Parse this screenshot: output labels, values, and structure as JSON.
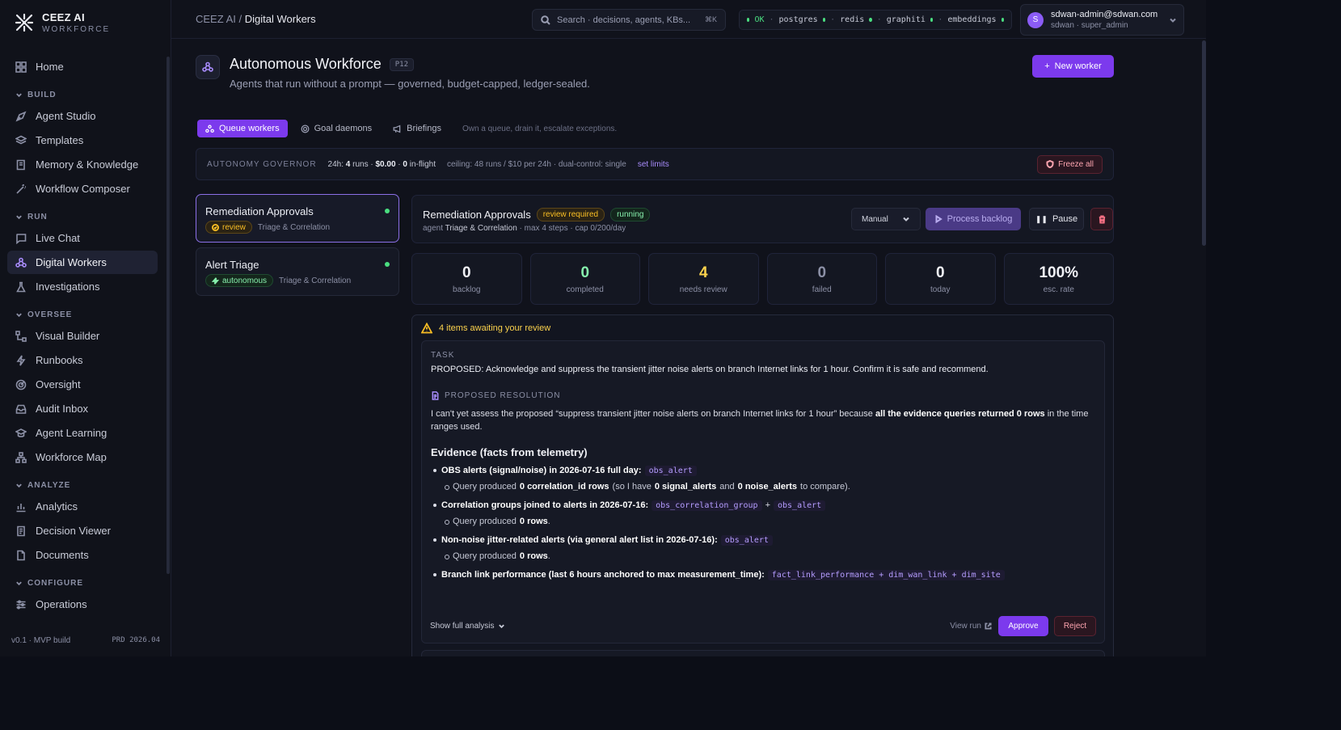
{
  "brand": {
    "name": "CEEZ AI",
    "sub": "WORKFORCE"
  },
  "sidebar": {
    "home": "Home",
    "build": {
      "title": "BUILD",
      "items": [
        "Agent Studio",
        "Templates",
        "Memory & Knowledge",
        "Workflow Composer"
      ]
    },
    "run": {
      "title": "RUN",
      "items": [
        "Live Chat",
        "Digital Workers",
        "Investigations"
      ]
    },
    "oversee": {
      "title": "OVERSEE",
      "items": [
        "Visual Builder",
        "Runbooks",
        "Oversight",
        "Audit Inbox",
        "Agent Learning",
        "Workforce Map"
      ]
    },
    "analyze": {
      "title": "ANALYZE",
      "items": [
        "Analytics",
        "Decision Viewer",
        "Documents"
      ]
    },
    "configure": {
      "title": "CONFIGURE",
      "items": [
        "Operations"
      ]
    },
    "footer": {
      "version": "v0.1 · MVP build",
      "build": "PRD 2026.04"
    }
  },
  "topbar": {
    "crumb_root": "CEEZ AI",
    "crumb_sep": "/",
    "crumb_current": "Digital Workers",
    "search_placeholder": "Search · decisions, agents, KBs...",
    "search_kbd": "⌘K",
    "health": {
      "ok": "OK",
      "services": [
        "postgres",
        "redis",
        "graphiti",
        "embeddings"
      ]
    },
    "user": {
      "initial": "S",
      "email": "sdwan-admin@sdwan.com",
      "role": "sdwan · super_admin"
    }
  },
  "page": {
    "title": "Autonomous Workforce",
    "badge": "P12",
    "subtitle": "Agents that run without a prompt — governed, budget-capped, ledger-sealed.",
    "new_worker": "New worker",
    "tabs": [
      "Queue workers",
      "Goal daemons",
      "Briefings"
    ],
    "tab_hint": "Own a queue, drain it, escalate exceptions."
  },
  "governor": {
    "title": "AUTONOMY GOVERNOR",
    "p1": "24h:",
    "runs": "4",
    "p2": "runs ·",
    "cost": "$0.00",
    "p3": "·",
    "inflight": "0",
    "p4": "in-flight",
    "ceiling": "ceiling: 48 runs / $10 per 24h · dual-control: single",
    "set_limits": "set limits",
    "freeze": "Freeze all"
  },
  "workers": [
    {
      "name": "Remediation Approvals",
      "mode": "review",
      "agent": "Triage & Correlation"
    },
    {
      "name": "Alert Triage",
      "mode": "autonomous",
      "agent": "Triage & Correlation"
    }
  ],
  "detail": {
    "name": "Remediation Approvals",
    "badge_review": "review required",
    "badge_status": "running",
    "sub_prefix": "agent",
    "sub_agent": "Triage & Correlation",
    "sub_suffix": "· max 4 steps · cap 0/200/day",
    "mode": "Manual",
    "process": "Process backlog",
    "pause": "Pause"
  },
  "stats": [
    {
      "value": "0",
      "label": "backlog",
      "color": "#f1f2f7"
    },
    {
      "value": "0",
      "label": "completed",
      "color": "#86efac"
    },
    {
      "value": "4",
      "label": "needs review",
      "color": "#fcd34d"
    },
    {
      "value": "0",
      "label": "failed",
      "color": "#8c90a6"
    },
    {
      "value": "0",
      "label": "today",
      "color": "#f1f2f7"
    },
    {
      "value": "100%",
      "label": "esc. rate",
      "color": "#f1f2f7"
    }
  ],
  "review": {
    "header": "4 items awaiting your review",
    "task_label": "TASK",
    "task": "PROPOSED: Acknowledge and suppress the transient jitter noise alerts on branch Internet links for 1 hour. Confirm it is safe and recommend.",
    "prop_label": "PROPOSED RESOLUTION",
    "prop_a": "I can't yet assess the proposed “suppress transient jitter noise alerts on branch Internet links for 1 hour” because",
    "prop_b": "all the evidence queries returned 0 rows",
    "prop_c": "in the time ranges used.",
    "evidence_title": "Evidence (facts from telemetry)",
    "e1": {
      "label": "OBS alerts (signal/noise) in 2026-07-16 full day:",
      "code": "obs_alert",
      "s_a": "Query produced",
      "s_b": "0 correlation_id rows",
      "s_c": "(so I have",
      "s_d": "0 signal_alerts",
      "s_e": "and",
      "s_f": "0 noise_alerts",
      "s_g": "to compare)."
    },
    "e2": {
      "label": "Correlation groups joined to alerts in 2026-07-16:",
      "code1": "obs_correlation_group",
      "plus": "+",
      "code2": "obs_alert",
      "s_a": "Query produced",
      "s_b": "0 rows",
      "s_c": "."
    },
    "e3": {
      "label": "Non-noise jitter-related alerts (via general alert list in 2026-07-16):",
      "code": "obs_alert",
      "s_a": "Query produced",
      "s_b": "0 rows",
      "s_c": "."
    },
    "e4": {
      "label": "Branch link performance (last 6 hours anchored to max measurement_time):",
      "code": "fact_link_performance + dim_wan_link + dim_site"
    },
    "show_more": "Show full analysis",
    "view_run": "View run",
    "approve": "Approve",
    "reject": "Reject"
  }
}
